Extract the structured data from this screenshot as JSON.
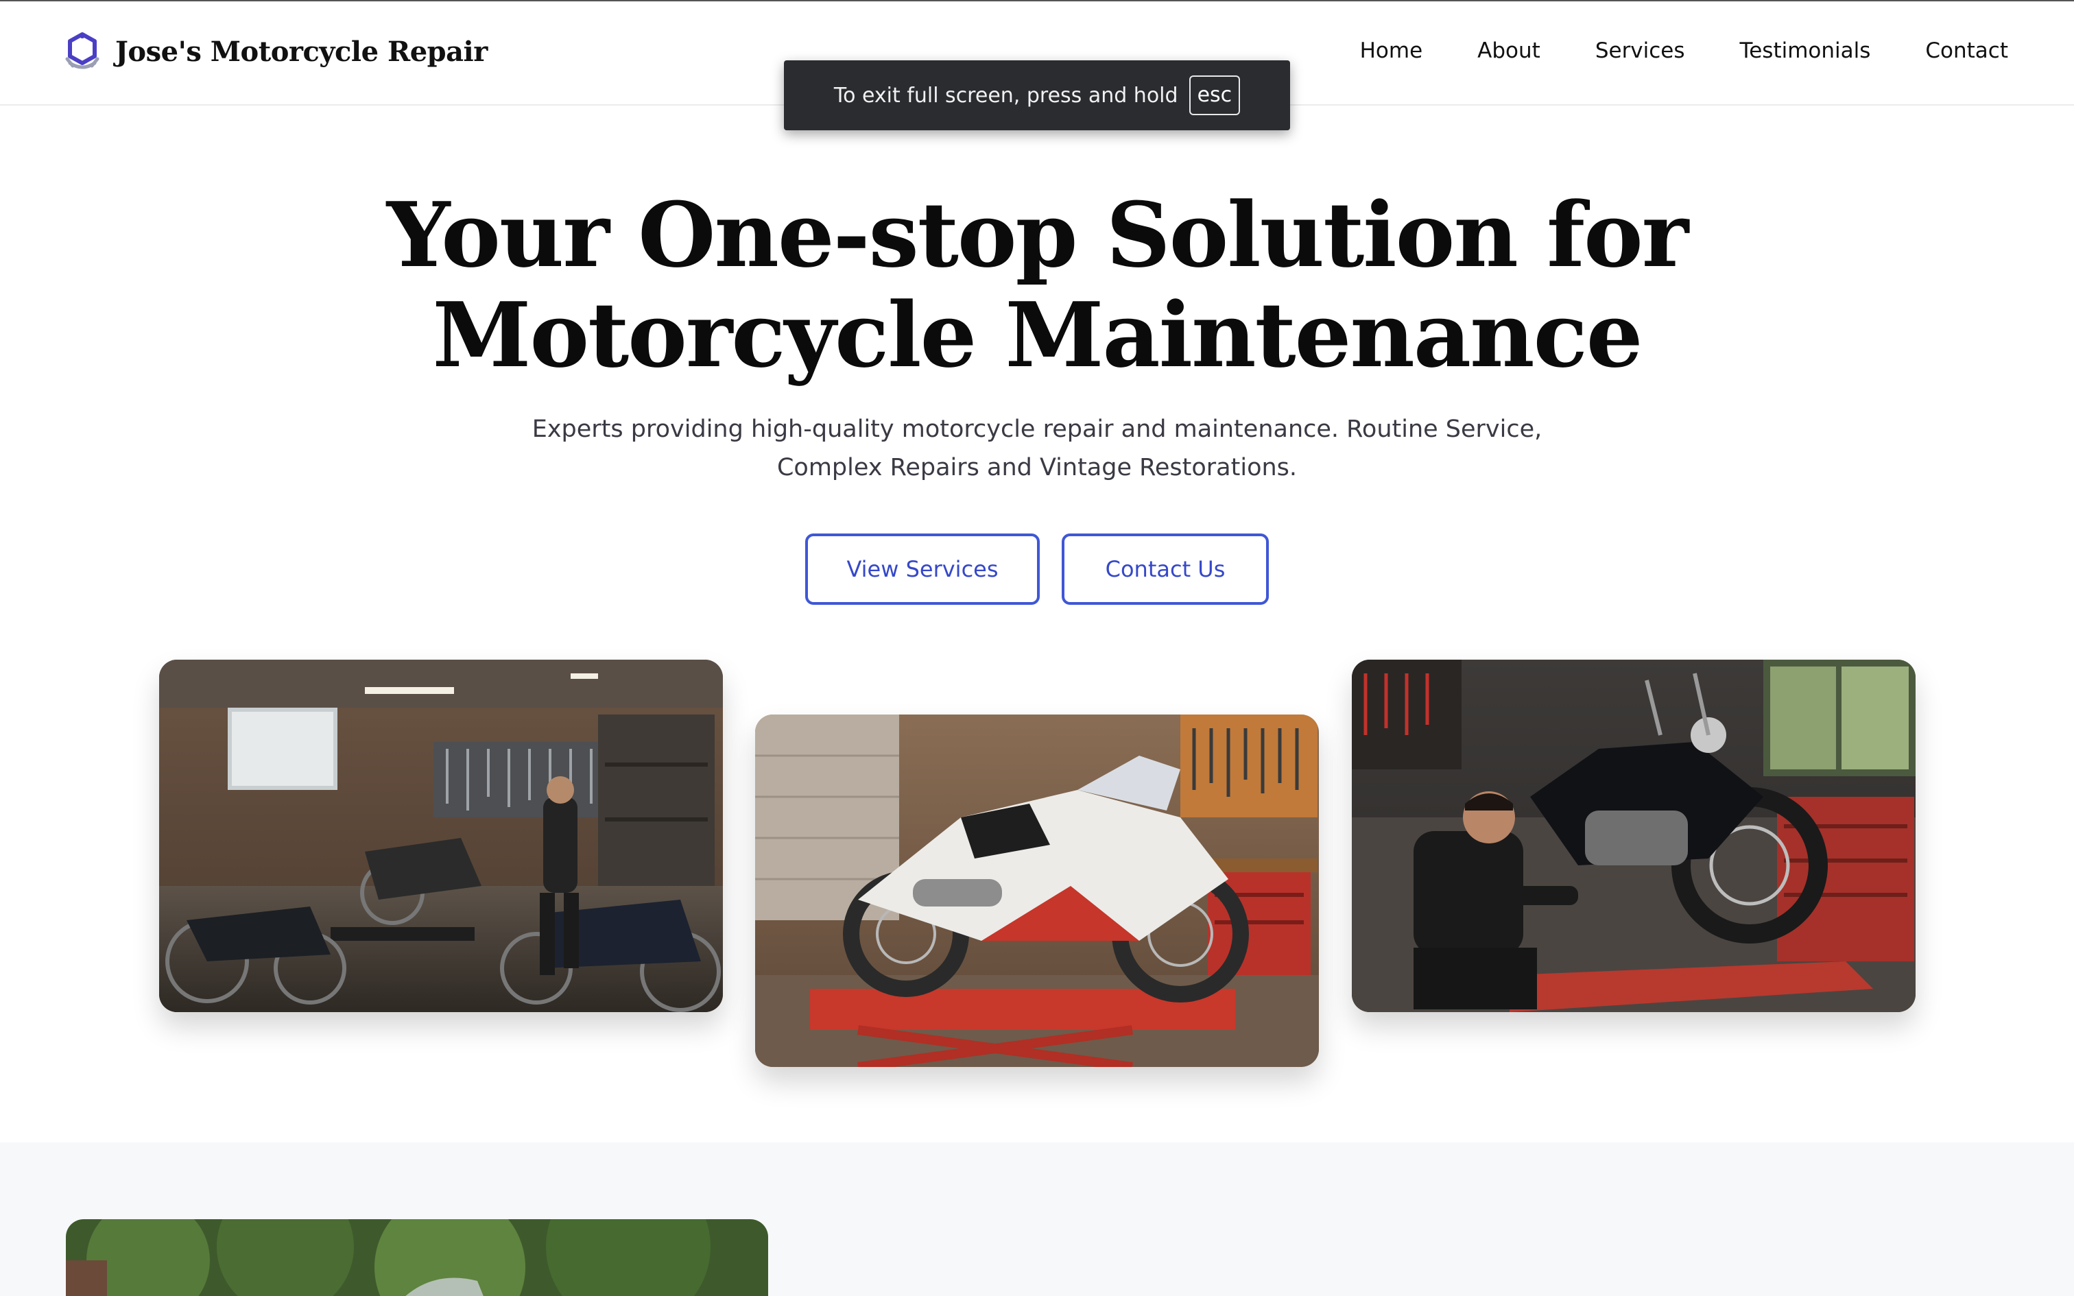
{
  "brand": {
    "name": "Jose's Motorcycle Repair",
    "icon": "wrench-gear-icon"
  },
  "nav": {
    "items": [
      {
        "label": "Home"
      },
      {
        "label": "About"
      },
      {
        "label": "Services"
      },
      {
        "label": "Testimonials"
      },
      {
        "label": "Contact"
      }
    ]
  },
  "fullscreen_toast": {
    "text": "To exit full screen, press and hold",
    "key": "esc"
  },
  "hero": {
    "title_line1": "Your One-stop Solution for",
    "title_line2": "Motorcycle Maintenance",
    "subtitle_line1": "Experts providing high-quality motorcycle repair and maintenance. Routine Service,",
    "subtitle_line2": "Complex Repairs and Vintage Restorations.",
    "buttons": {
      "view_services": "View Services",
      "contact_us": "Contact Us"
    }
  },
  "colors": {
    "accent": "#3f57d6",
    "toast_bg": "#2a2c30",
    "section_bg": "#f7f8fa",
    "title": "#0b0b0b"
  },
  "gallery": [
    {
      "subject": "garage-with-classic-motorcycles-photo"
    },
    {
      "subject": "sport-bike-on-red-lift-photo"
    },
    {
      "subject": "mechanic-working-on-cruiser-photo"
    }
  ]
}
